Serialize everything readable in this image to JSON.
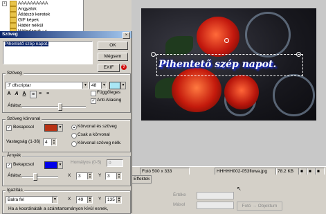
{
  "folders": [
    "AAAAAAAAAA",
    "Angyalok",
    "Átlátszó keretek",
    "GIF képek",
    "Háttér nélkül",
    "Hátterlapok - c"
  ],
  "photo_caption": "Pihentető szép napot.",
  "statusbar": {
    "photo_size": "Fotó 500 x 333",
    "filename": "HHHHH002-053flowa.jpg",
    "file_size": "78.2 KB"
  },
  "lower": {
    "effects_tab": "Effektek",
    "field_a": "Értéke",
    "field_b": "Másol",
    "photo_to_object_button": "Fotó → Objektum"
  },
  "dialog": {
    "title": "Szöveg",
    "text_value": "Pihentető szép napot.",
    "ok_button": "OK",
    "cancel_button": "Mégsem",
    "exif_button": "EXIF",
    "help_icon": "?",
    "text_group": {
      "title": "Szöveg",
      "font_name": "dfscriptar",
      "font_size": "48",
      "color": "#a9e6f4",
      "vertical_label": "Függőleges",
      "antialias_label": "Anti Aliasing",
      "transparency_label": "Átlátsz."
    },
    "outline_group": {
      "title": "Szöveg körvonal",
      "enable_label": "Bekapcsol",
      "color": "#b83214",
      "options": [
        "Körvonal és szöveg",
        "Csak a körvonal",
        "Körvonal szöveg nélk."
      ],
      "thickness_label": "Vastagság (1-36)",
      "thickness_value": "4"
    },
    "shadow_group": {
      "title": "Árnyék",
      "enable_label": "Bekapcsol",
      "color": "#0000e8",
      "transparency_label": "Átlátsz.",
      "blur_label": "Homályos (0-5)",
      "blur_value": "0",
      "x_label": "X",
      "x_value": "3",
      "y_label": "Y",
      "y_value": "3"
    },
    "align_group": {
      "title": "Igazítás",
      "position_value": "Balra fel",
      "x_label": "X",
      "x_value": "49",
      "y_label": "Y",
      "y_value": "135",
      "note": "Ha a koordináták a számtartományon kívül esnek,"
    }
  }
}
